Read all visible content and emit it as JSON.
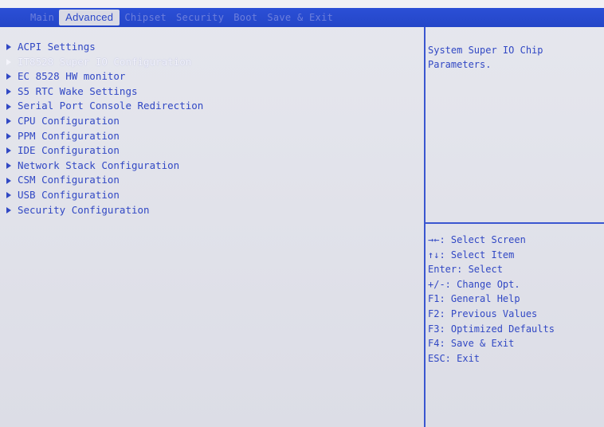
{
  "tabs": [
    {
      "label": "Main"
    },
    {
      "label": "Advanced"
    },
    {
      "label": "Chipset"
    },
    {
      "label": "Security"
    },
    {
      "label": "Boot"
    },
    {
      "label": "Save & Exit"
    }
  ],
  "menu": {
    "items": [
      {
        "label": "ACPI Settings"
      },
      {
        "label": "IT8528 Super IO Configuration"
      },
      {
        "label": "EC 8528 HW monitor"
      },
      {
        "label": "S5 RTC Wake Settings"
      },
      {
        "label": "Serial Port Console Redirection"
      },
      {
        "label": "CPU Configuration"
      },
      {
        "label": "PPM Configuration"
      },
      {
        "label": "IDE Configuration"
      },
      {
        "label": "Network Stack Configuration"
      },
      {
        "label": "CSM Configuration"
      },
      {
        "label": "USB Configuration"
      },
      {
        "label": "Security Configuration"
      }
    ],
    "selected_index": 1
  },
  "help": {
    "text": "System Super IO Chip Parameters."
  },
  "keys": [
    {
      "text": "→←: Select Screen"
    },
    {
      "text": "↑↓: Select Item"
    },
    {
      "text": "Enter: Select"
    },
    {
      "text": "+/-: Change Opt."
    },
    {
      "text": "F1: General Help"
    },
    {
      "text": "F2: Previous Values"
    },
    {
      "text": "F3: Optimized Defaults"
    },
    {
      "text": "F4: Save & Exit"
    },
    {
      "text": "ESC: Exit"
    }
  ],
  "colors": {
    "background": "#e6e7ee",
    "title_bar": "#2446c8",
    "text": "#3148c4",
    "selected_text": "#f4f4fb",
    "divider": "#3a56d0"
  }
}
